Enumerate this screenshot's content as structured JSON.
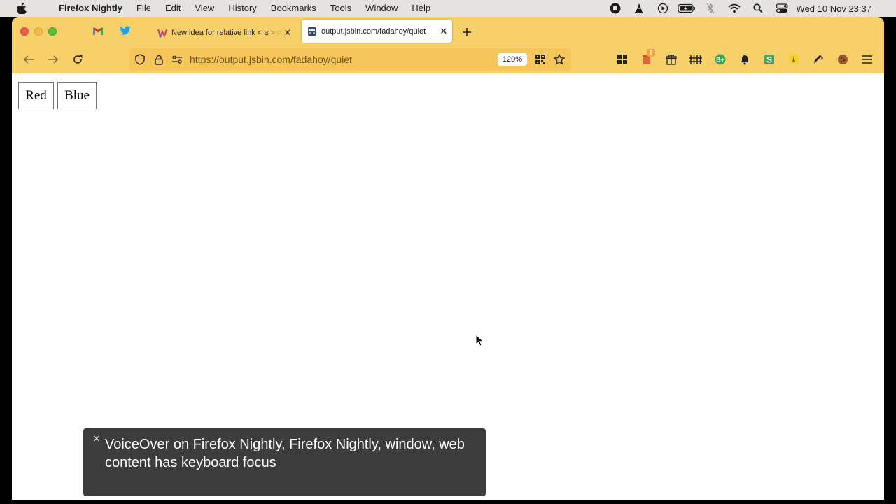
{
  "menubar": {
    "app_name": "Firefox Nightly",
    "items": [
      "File",
      "Edit",
      "View",
      "History",
      "Bookmarks",
      "Tools",
      "Window",
      "Help"
    ],
    "clock": "Wed 10 Nov  23:37",
    "status_icons": [
      "record-icon",
      "vlc-icon",
      "play-icon",
      "battery-icon",
      "bluetooth-icon",
      "wifi-icon",
      "spotlight-icon",
      "control-center-icon"
    ]
  },
  "window": {
    "pinned_tabs": [
      {
        "icon": "gmail-icon"
      },
      {
        "icon": "twitter-icon"
      }
    ],
    "tabs": [
      {
        "title": "New idea for relative link < a > a",
        "active": false
      },
      {
        "title": "output.jsbin.com/fadahoy/quiet",
        "active": true
      }
    ],
    "url": "https://output.jsbin.com/fadahoy/quiet",
    "zoom": "120%",
    "extension_badge": "2"
  },
  "page": {
    "buttons": [
      "Red",
      "Blue"
    ]
  },
  "voiceover": {
    "text": "VoiceOver on Firefox Nightly, Firefox Nightly, window, web content has keyboard focus",
    "close": "×"
  },
  "colors": {
    "toolbar": "#f8d06a",
    "urlbar": "#f6c65b",
    "menubar": "#e4e3df",
    "voiceover_bg": "#3c3c3c"
  }
}
